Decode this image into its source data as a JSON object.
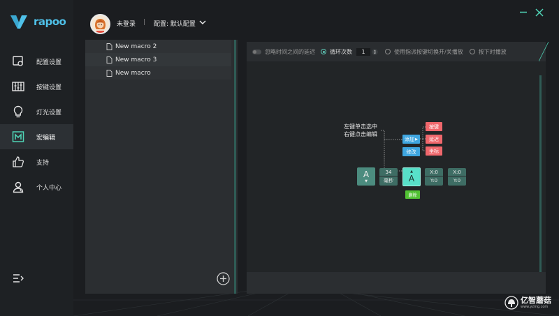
{
  "brand": {
    "word": "rapoo",
    "accent": "#4fc1e9"
  },
  "sidebar": {
    "items": [
      {
        "label": "配置设置",
        "icon": "settings-screen-icon",
        "active": false
      },
      {
        "label": "按键设置",
        "icon": "keyboard-sliders-icon",
        "active": false
      },
      {
        "label": "灯光设置",
        "icon": "lightbulb-icon",
        "active": false
      },
      {
        "label": "宏编辑",
        "icon": "macro-m-icon",
        "active": true
      },
      {
        "label": "支持",
        "icon": "thumbs-up-icon",
        "active": false
      },
      {
        "label": "个人中心",
        "icon": "user-icon",
        "active": false
      }
    ],
    "collapse_icon": "menu-collapse-icon"
  },
  "header": {
    "user_name": "未登录",
    "separator": "|",
    "config_label": "配置: 默认配置"
  },
  "macro_list": {
    "items": [
      "New macro 2",
      "New macro 3",
      "New macro"
    ],
    "add_icon": "plus-circle-icon"
  },
  "toolbar": {
    "ignore_delay_label": "忽略时间之间的延迟",
    "loop_label": "循环次数",
    "loop_count": "1",
    "toggle_label": "使用指派按键切换开/关播放",
    "hold_label": "按下时播放"
  },
  "help": {
    "line1": "左键单击选中",
    "line2": "右键点击编辑",
    "add": "添加",
    "edit": "修改",
    "key": "按键",
    "delay": "延迟",
    "coord": "坐标",
    "delete": "删除"
  },
  "blocks": {
    "a1_letter": "A",
    "time_value": "34",
    "time_unit": "毫秒",
    "a2_letter": "A",
    "xy1_x": "X:0",
    "xy1_y": "Y:0",
    "xy2_x": "X:0",
    "xy2_y": "Y:0"
  },
  "watermark": {
    "big": "亿智蘑菇",
    "small": "www.yzmg.com"
  }
}
